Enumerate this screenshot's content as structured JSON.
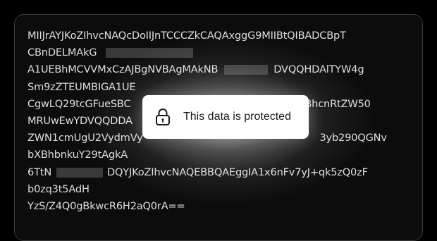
{
  "code_block": {
    "lines": [
      {
        "segments": [
          "MIIJrAYJKoZIhvcNAQcDoIIJnTCCCZkCAQAxggG9MIIBtQIBADCBpT"
        ]
      },
      {
        "segments": [
          "CBnDELMAkG",
          ""
        ]
      },
      {
        "segments": [
          "A1UEBhMCVVMxCzAJBgNVBAgMAkNB",
          "",
          "DVQQHDAlTYW4g"
        ]
      },
      {
        "segments": [
          "Sm9zZTEUMBIGA1UE"
        ]
      },
      {
        "segments": [
          "CgwLQ29tcGFueSBC",
          "",
          "BhcnRtZW50"
        ]
      },
      {
        "segments": [
          "MRUwEwYDVQQDDA"
        ]
      },
      {
        "segments": [
          "ZWN1cmUgU2VydmVy",
          "",
          "3yb290QGNv"
        ]
      },
      {
        "segments": [
          "bXBhbnkuY29tAgkA"
        ]
      },
      {
        "segments": [
          "6TtN",
          "",
          "DQYJKoZIhvcNAQEBBQAEggIA1x6nFv7yJ+qk5zQ0zF"
        ]
      },
      {
        "segments": [
          "b0zq3t5AdH"
        ]
      },
      {
        "segments": [
          "YzS/Z4Q0gBkwcR6H2aQ0rA=="
        ]
      }
    ]
  },
  "protected_notice": {
    "icon": "lock-icon",
    "message": "This data is protected"
  },
  "colors": {
    "background": "#000000",
    "panel": "#0c0c0c",
    "panel_border": "#3a3a3a",
    "text": "#dedede",
    "redaction": "#3a3a3a",
    "toast_bg": "#ffffff",
    "toast_text": "#1a1a1a"
  }
}
